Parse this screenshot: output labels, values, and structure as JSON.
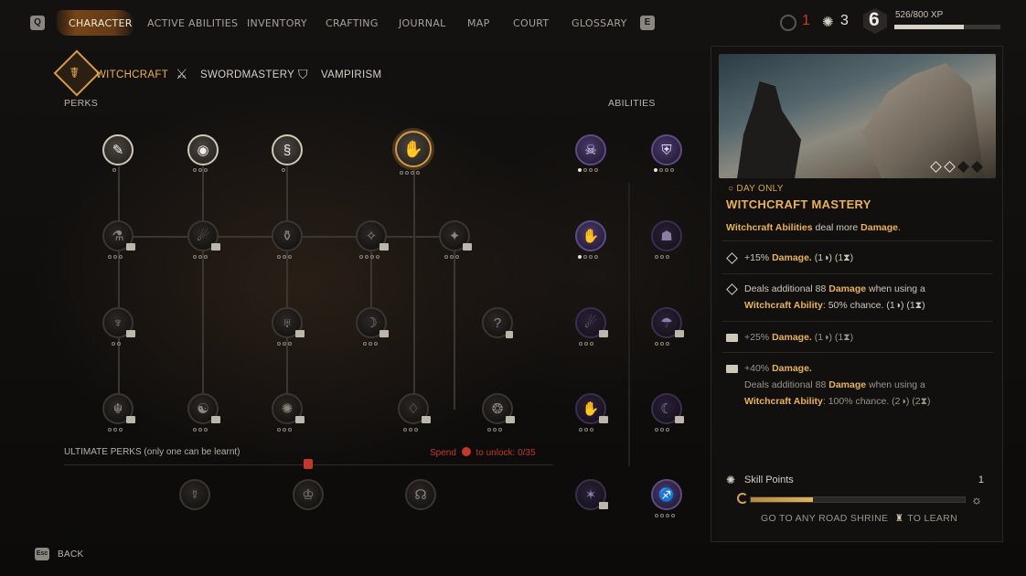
{
  "nav": {
    "left_key": "Q",
    "tabs": [
      {
        "label": "CHARACTER",
        "active": true
      },
      {
        "label": "ACTIVE ABILITIES"
      },
      {
        "label": "INVENTORY"
      },
      {
        "label": "CRAFTING"
      },
      {
        "label": "JOURNAL"
      },
      {
        "label": "MAP"
      },
      {
        "label": "COURT"
      },
      {
        "label": "GLOSSARY"
      }
    ],
    "right_key": "E",
    "counter_red": "1",
    "skill_points": "3",
    "level": "6",
    "xp_text": "526/800 XP",
    "xp_progress": 0.6575
  },
  "trees": {
    "tabs": [
      {
        "label": "WITCHCRAFT",
        "active": true
      },
      {
        "label": "SWORDMASTERY"
      },
      {
        "label": "VAMPIRISM"
      }
    ],
    "perks_label": "PERKS",
    "abilities_label": "ABILITIES"
  },
  "ultimate": {
    "label": "ULTIMATE PERKS (only one can be learnt)",
    "spend_prefix": "Spend",
    "spend_suffix": "to unlock: 0/35"
  },
  "detail": {
    "note": "DAY ONLY",
    "title": "WITCHCRAFT MASTERY",
    "desc_a": "Witchcraft Abilities",
    "desc_b": " deal more ",
    "desc_c": "Damage",
    "desc_d": ".",
    "rows": [
      {
        "pre": "+15% ",
        "hl": "Damage.",
        "post": " (1◑) (1⧗)"
      },
      {
        "line1_pre": "Deals additional 88 ",
        "line1_hl": "Damage",
        "line1_post": " when using a",
        "line2_hl": "Witchcraft Ability",
        "line2_post": ": 50% chance. (1◑) (1⧗)"
      },
      {
        "pre": "+25% ",
        "hl": "Damage.",
        "post": " (1◑) (1⧗)"
      },
      {
        "pre": "+40% ",
        "hl": "Damage.",
        "line2_pre": "Deals additional 88 ",
        "line2_hl": "Damage",
        "line2_post": " when using a",
        "line3_hl": "Witchcraft Ability",
        "line3_post": ": 100% chance. (2◑) (2⧗)"
      }
    ],
    "skill_points_label": "Skill Points",
    "skill_points_value": "1",
    "progress": 0.29,
    "go_text": "GO TO ANY ROAD SHRINE",
    "go_suffix": "TO LEARN"
  },
  "back": {
    "key": "Esc",
    "label": "BACK"
  },
  "colors": {
    "accent": "#e8b25a",
    "warning": "#c0392b",
    "ability": "#5e4a84"
  }
}
